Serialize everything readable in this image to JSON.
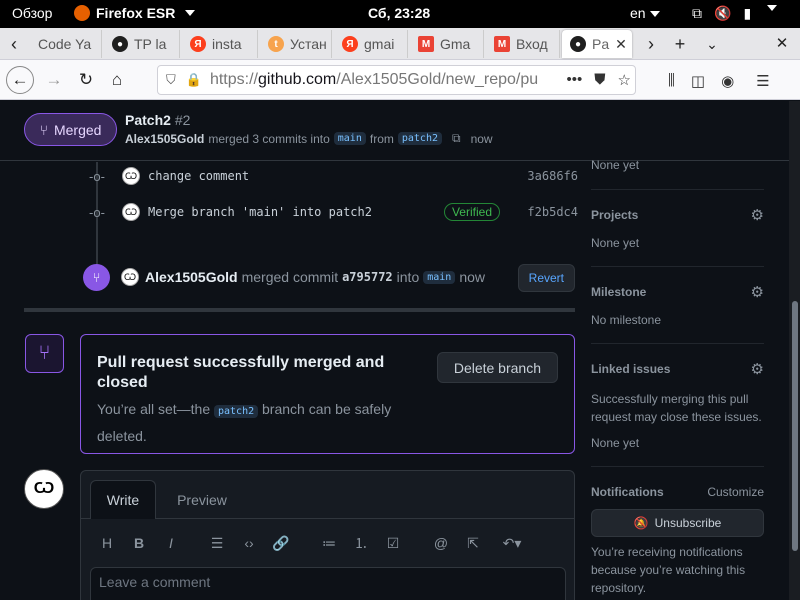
{
  "topbar": {
    "overview": "Обзор",
    "app": "Firefox ESR",
    "clock": "Сб, 23:28",
    "lang": "en"
  },
  "tabs": [
    {
      "label": "Code Ya",
      "favicon": "code-icon",
      "color": "#ffffff"
    },
    {
      "label": "TP la",
      "favicon": "github-icon",
      "color": "#1f1f1f"
    },
    {
      "label": "insta",
      "favicon": "yandex-icon",
      "color": "#fc3f1d"
    },
    {
      "label": "Устан",
      "favicon": "site-icon",
      "color": "#f7a34d"
    },
    {
      "label": "gmai",
      "favicon": "yandex-icon",
      "color": "#fc3f1d"
    },
    {
      "label": "Gma",
      "favicon": "gmail-icon",
      "color": "#ea4335"
    },
    {
      "label": "Вход",
      "favicon": "gmail-icon",
      "color": "#ea4335"
    },
    {
      "label": "Pa",
      "favicon": "github-icon",
      "color": "#1f1f1f"
    }
  ],
  "url": {
    "prefix": "https://",
    "host": "github.com",
    "path": "/Alex1505Gold/new_repo/pu"
  },
  "pr": {
    "state": "Merged",
    "title": "Patch2",
    "number": "#2",
    "author": "Alex1505Gold",
    "merged_text": "merged 3 commits into",
    "base": "main",
    "from_text": "from",
    "head": "patch2",
    "time": "now"
  },
  "commits": [
    {
      "message": "change comment",
      "sha": "3a686f6",
      "verified": ""
    },
    {
      "message": "Merge branch 'main' into patch2",
      "sha": "f2b5dc4",
      "verified": "Verified"
    }
  ],
  "merge_event": {
    "author": "Alex1505Gold",
    "text": "merged commit",
    "sha": "a795772",
    "into": "into",
    "branch": "main",
    "time": "now",
    "revert": "Revert"
  },
  "merged_box": {
    "title": "Pull request successfully merged and closed",
    "desc_before": "You’re all set—the",
    "branch": "patch2",
    "desc_after": "branch can be safely deleted.",
    "delete_button": "Delete branch"
  },
  "comment": {
    "tab_write": "Write",
    "tab_preview": "Preview",
    "placeholder": "Leave a comment"
  },
  "sidebar": {
    "top_value": "None yet",
    "projects": {
      "label": "Projects",
      "value": "None yet"
    },
    "milestone": {
      "label": "Milestone",
      "value": "No milestone"
    },
    "linked": {
      "label": "Linked issues",
      "desc": "Successfully merging this pull request may close these issues.",
      "value": "None yet"
    },
    "notifications": {
      "label": "Notifications",
      "customize": "Customize",
      "button": "Unsubscribe",
      "desc": "You’re receiving notifications because you’re watching this repository."
    }
  },
  "colors": {
    "merged": "#8957e5",
    "link": "#58a6ff",
    "bg": "#0d1117",
    "verified": "#3fb950"
  }
}
